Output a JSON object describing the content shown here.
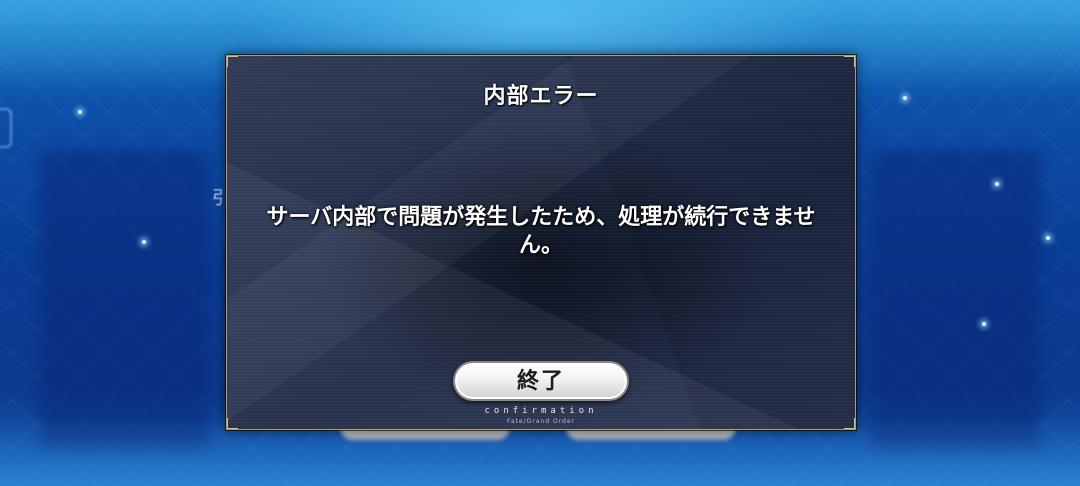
{
  "background": {
    "partial_char": "引"
  },
  "dialog": {
    "title": "内部エラー",
    "message": "サーバ内部で問題が発生したため、処理が続行できません。",
    "button_label": "終了",
    "confirm_label": "confirmation",
    "brand_label": "Fate/Grand Order"
  },
  "colors": {
    "dialog_border": "#b59a66",
    "dialog_fill": "#24304d",
    "background_blue": "#0a3c94"
  },
  "icons": [
    "sparkle-icon"
  ]
}
